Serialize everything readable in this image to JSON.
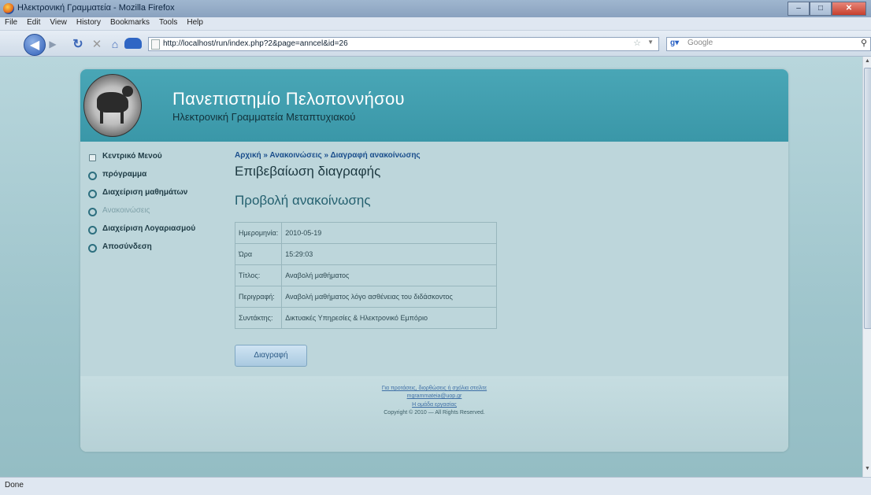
{
  "window": {
    "title": "Ηλεκτρονική Γραμματεία - Mozilla Firefox",
    "controls": [
      "–",
      "□",
      "✕"
    ]
  },
  "menu": [
    "File",
    "Edit",
    "View",
    "History",
    "Bookmarks",
    "Tools",
    "Help"
  ],
  "nav": {
    "url": "http://localhost/run/index.php?2&page=anncel&id=26",
    "search_engine": "Google"
  },
  "site": {
    "title": "Πανεπιστημίο Πελοποννήσου",
    "subtitle": "Ηλεκτρονική Γραμματεία Μεταπτυχιακού"
  },
  "sidebar": {
    "items": [
      {
        "label": "Κεντρικό Μενού",
        "style": "square"
      },
      {
        "label": "πρόγραμμα",
        "style": "circle"
      },
      {
        "label": "Διαχείριση μαθημάτων",
        "style": "circle"
      },
      {
        "label": "Ανακοινώσεις",
        "style": "muted"
      },
      {
        "label": "Διαχείριση Λογαριασμού",
        "style": "circle"
      },
      {
        "label": "Αποσύνδεση",
        "style": "circle"
      }
    ]
  },
  "breadcrumb": {
    "home": "Αρχική",
    "separator1": "»",
    "announcements": "Ανακοινώσεις",
    "separator2": "»",
    "current": "Διαγραφή ανακοίνωσης"
  },
  "content": {
    "confirm_title": "Επιβεβαίωση διαγραφής",
    "section_title": "Προβολή ανακοίνωσης",
    "details": [
      {
        "key": "Ημερομηνία:",
        "value": "2010-05-19"
      },
      {
        "key": "Ώρα",
        "value": "15:29:03"
      },
      {
        "key": "Τίτλος:",
        "value": "Αναβολή μαθήματος"
      },
      {
        "key": "Περιγραφή:",
        "value": "Αναβολή μαθήματος λόγο ασθένειας του διδάσκοντος"
      },
      {
        "key": "Συντάκτης:",
        "value": "Δικτυακές Υπηρεσίες & Ηλεκτρονικό Εμπόριο"
      }
    ],
    "delete_label": "Διαγραφή"
  },
  "footer": {
    "line1": "Για προτάσεις, διορθώσεις ή σχόλια στείλτε",
    "line2": "mgrammateia@uop.gr",
    "line3": "Η ομάδα εργασίας",
    "line4": "Copyright © 2010 — All Rights Reserved."
  },
  "status": "Done",
  "colors": {
    "header": "#3a97a8",
    "background": "#9fc5cc",
    "link": "#1a4e8c"
  }
}
